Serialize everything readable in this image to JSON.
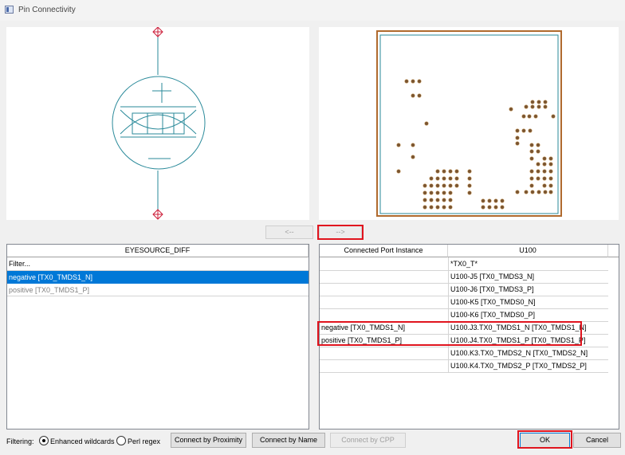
{
  "window": {
    "title": "Pin Connectivity"
  },
  "colors": {
    "symbol": "#2a8a9a",
    "pin_marker": "#cc1f3a",
    "board_outline": "#b06a2e",
    "board_inner": "#2a8a9a",
    "pad_fill": "#7a5530",
    "highlight": "#e0141e",
    "selection": "#0078d7"
  },
  "arrows": {
    "left_label": "<--",
    "right_label": "-->"
  },
  "left_table": {
    "header": "EYESOURCE_DIFF",
    "filter_placeholder": "Filter...",
    "rows": [
      {
        "label": "negative [TX0_TMDS1_N]",
        "selected": true
      },
      {
        "label": "positive [TX0_TMDS1_P]",
        "selected": false
      }
    ]
  },
  "right_table": {
    "headers": [
      "Connected Port Instance",
      "U100"
    ],
    "filter_value": "*TX0_T*",
    "rows": [
      {
        "port": "",
        "pin": "U100-J5 [TX0_TMDS3_N]"
      },
      {
        "port": "",
        "pin": "U100-J6 [TX0_TMDS3_P]"
      },
      {
        "port": "",
        "pin": "U100-K5 [TX0_TMDS0_N]"
      },
      {
        "port": "",
        "pin": "U100-K6 [TX0_TMDS0_P]"
      },
      {
        "port": "negative [TX0_TMDS1_N]",
        "pin": "U100.J3.TX0_TMDS1_N [TX0_TMDS1_N]"
      },
      {
        "port": "positive [TX0_TMDS1_P]",
        "pin": "U100.J4.TX0_TMDS1_P [TX0_TMDS1_P]"
      },
      {
        "port": "",
        "pin": "U100.K3.TX0_TMDS2_N [TX0_TMDS2_N]"
      },
      {
        "port": "",
        "pin": "U100.K4.TX0_TMDS2_P [TX0_TMDS2_P]"
      }
    ]
  },
  "filtering": {
    "label": "Filtering:",
    "options": [
      {
        "label": "Enhanced wildcards",
        "checked": true
      },
      {
        "label": "Perl regex",
        "checked": false
      }
    ]
  },
  "buttons": {
    "connect_proximity": "Connect by Proximity",
    "connect_name": "Connect by Name",
    "connect_cpp": "Connect by CPP",
    "ok": "OK",
    "cancel": "Cancel"
  }
}
